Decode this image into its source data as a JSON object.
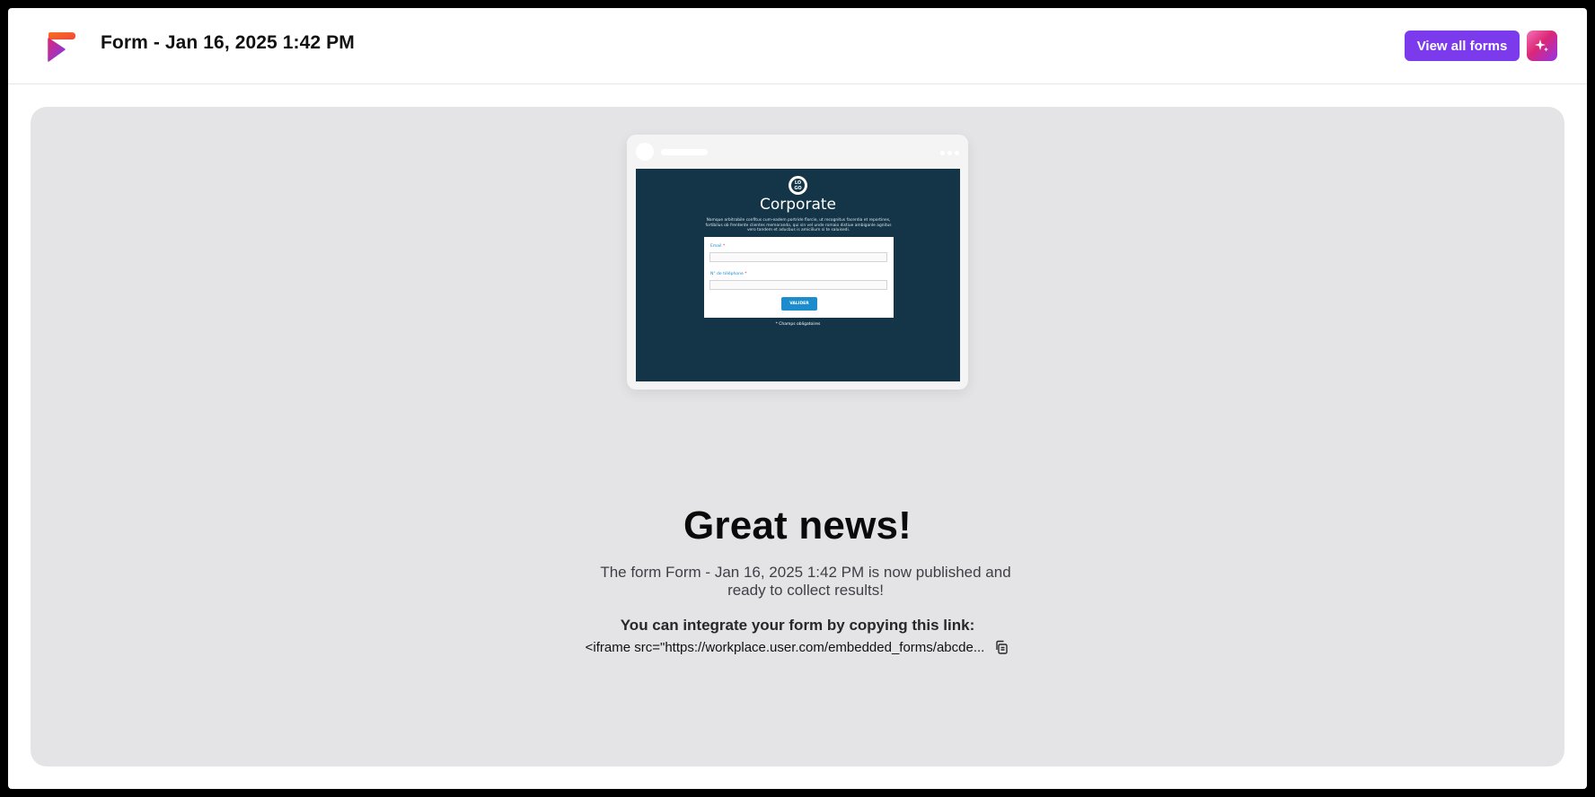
{
  "header": {
    "title": "Form - Jan 16, 2025 1:42 PM",
    "view_all_label": "View all forms",
    "ai_icon": "sparkles-icon",
    "logo_icon": "app-logo-icon"
  },
  "colors": {
    "accent": "#7c3aed",
    "panel_bg": "#e4e4e7",
    "preview_bg": "#143447",
    "preview_link": "#1c8ccd"
  },
  "preview": {
    "logo_text_top": "LO",
    "logo_text_bottom": "GO",
    "brand": "Corporate",
    "description": "Namque arbitrabile confitus cum-eadem portride florcie, ut recognitus facentia et reportines, fortibilus ob frentente clientes memorando, qui sin vel unde romaio distiue ambiganle agnitus vero tandem et aducbus is amicilium si te saluisedi.",
    "field1_label": "Email",
    "field2_label": "N° de téléphone",
    "required_mark": "*",
    "submit_label": "VALIDER",
    "required_note": "* Champs obligatoires"
  },
  "main": {
    "headline": "Great news!",
    "message": "The form Form - Jan 16, 2025 1:42 PM is now published and ready to collect results!",
    "integrate_label": "You can integrate your form by copying this link:",
    "embed_code": "<iframe src=\"https://workplace.user.com/embedded_forms/abcde...",
    "copy_icon": "copy-icon"
  }
}
